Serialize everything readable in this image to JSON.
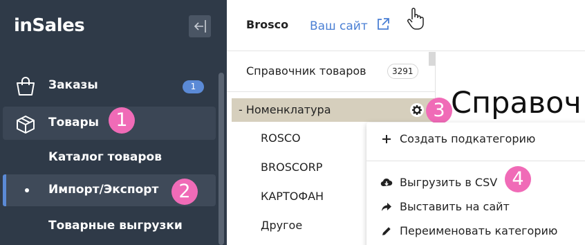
{
  "sidebar": {
    "logo": "inSales",
    "items": [
      {
        "label": "Заказы",
        "badge": "1"
      },
      {
        "label": "Товары"
      }
    ],
    "subitems": [
      {
        "label": "Каталог товаров"
      },
      {
        "label": "Импорт/Экспорт"
      },
      {
        "label": "Товарные выгрузки"
      }
    ]
  },
  "topbar": {
    "brand": "Brosco",
    "site_link": "Ваш сайт"
  },
  "directory": {
    "title": "Справочник товаров",
    "count": "3291",
    "active_category": "- Номенклатура",
    "categories": [
      "ROSCO",
      "BROSCORP",
      "КАРТОФАН",
      "Другое"
    ]
  },
  "main": {
    "title": "Справоч"
  },
  "context_menu": {
    "items": [
      {
        "label": "Создать подкатегорию",
        "icon": "plus-icon"
      },
      {
        "label": "Выгрузить в CSV",
        "icon": "cloud-download-icon"
      },
      {
        "label": "Выставить на сайт",
        "icon": "share-arrow-icon"
      },
      {
        "label": "Переименовать категорию",
        "icon": "pencil-icon"
      }
    ]
  },
  "steps": [
    "1",
    "2",
    "3",
    "4"
  ],
  "colors": {
    "sidebar_bg": "#2f3a48",
    "accent": "#5b8ad6",
    "step_marker": "#f06bb7",
    "active_category_bg": "#d6cfbd",
    "link": "#4a7fd4"
  }
}
